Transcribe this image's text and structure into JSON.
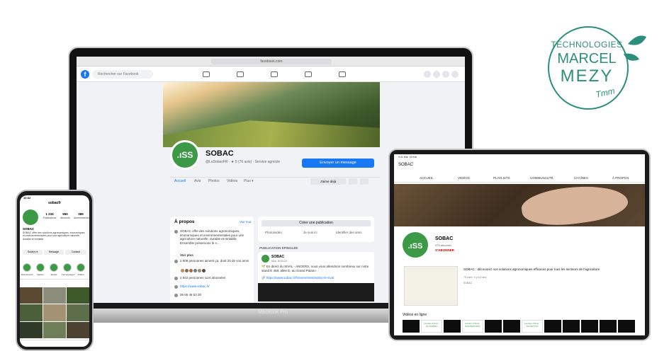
{
  "brand": {
    "line1": "TECHNOLOGIES",
    "line2": "MARCEL",
    "line3": "MEZY",
    "signature": "Tmm",
    "color": "#2c8f7b"
  },
  "laptop": {
    "label": "MacBook Pro",
    "url": "facebook.com",
    "search_placeholder": "Rechercher sur Facebook",
    "page_name": "SOBAC",
    "page_sub": "@LaSobacFR · ★ 5 (76 avis) · Service agricole",
    "message_button": "Envoyer un message",
    "like_button": "J'aime déjà",
    "tabs": [
      "Accueil",
      "Avis",
      "Photos",
      "Vidéos",
      "Plus ▾"
    ],
    "about": {
      "title": "À propos",
      "edit_link": "Voir tout",
      "description": "SOBAC offre des solutions agronomiques, économiques et environnementales pour une agriculture naturelle, durable et rentable. Ensemble préservons le s…",
      "see_more": "Voir plus",
      "likes": "2 608 personnes aiment ça, dont 20 de vos amis",
      "followers": "2 842 personnes sont abonnées",
      "website": "https://www.sobac.fr/",
      "phone": "05 65 46 63 30"
    },
    "post_box": {
      "create": "Créer une publication",
      "actions": [
        "Photo/vidéo",
        "Je suis ici",
        "Identifier des amis"
      ]
    },
    "pinned_label": "PUBLICATION ÉPINGLÉE",
    "post": {
      "author": "SOBAC",
      "date": "Mar. 8:05:22 ·",
      "text": "🌱 En direct du SIVAL - ANGERS, nous vous attendons nombreux sur notre stand E 458, allée E, au Grand Palais !",
      "link": "🔗 https://www.sobac.fr/fr/evenement/salon-le-sival"
    }
  },
  "phone": {
    "time": "10:32",
    "username": "sobacfr",
    "stats": [
      {
        "n": "1 234",
        "l": "Publications"
      },
      {
        "n": "950",
        "l": "Abonnés"
      },
      {
        "n": "389",
        "l": "Abonnements"
      }
    ],
    "name": "SOBAC",
    "bio": "SOBAC offre des solutions agronomiques, économiques et environnementales pour une agriculture naturelle, durable et rentable.",
    "buttons": [
      "Suivi(e) ▾",
      "Message",
      "Contact"
    ],
    "highlights": [
      "Événements",
      "Salons",
      "Essais",
      "Témoignages",
      "Vidéos"
    ]
  },
  "tablet": {
    "status": "9:41 Mar. 18 mai",
    "channel_title": "SOBAC",
    "tabs": [
      "ACCUEIL",
      "VIDÉOS",
      "PLAYLISTS",
      "COMMUNAUTÉ",
      "CHAÎNES",
      "À PROPOS"
    ],
    "channel_name": "SOBAC",
    "subscribers": "975 abonnés",
    "subscribe": "S'ABONNER",
    "video_title": "SOBAC : découvrez nos solutions agronomiques efficaces pour tous les secteurs de l'agriculture",
    "video_meta": "79 vues · il y a 4 ans",
    "video_channel": "SOBAC",
    "section": "Vidéos en ligne",
    "thumb_labels": [
      "Lumière d'hiver : GLUTERRA",
      "Lumière d'hiver : BACTÉRIOSOL",
      "Lumière d'hiver : NUTRITION"
    ]
  }
}
